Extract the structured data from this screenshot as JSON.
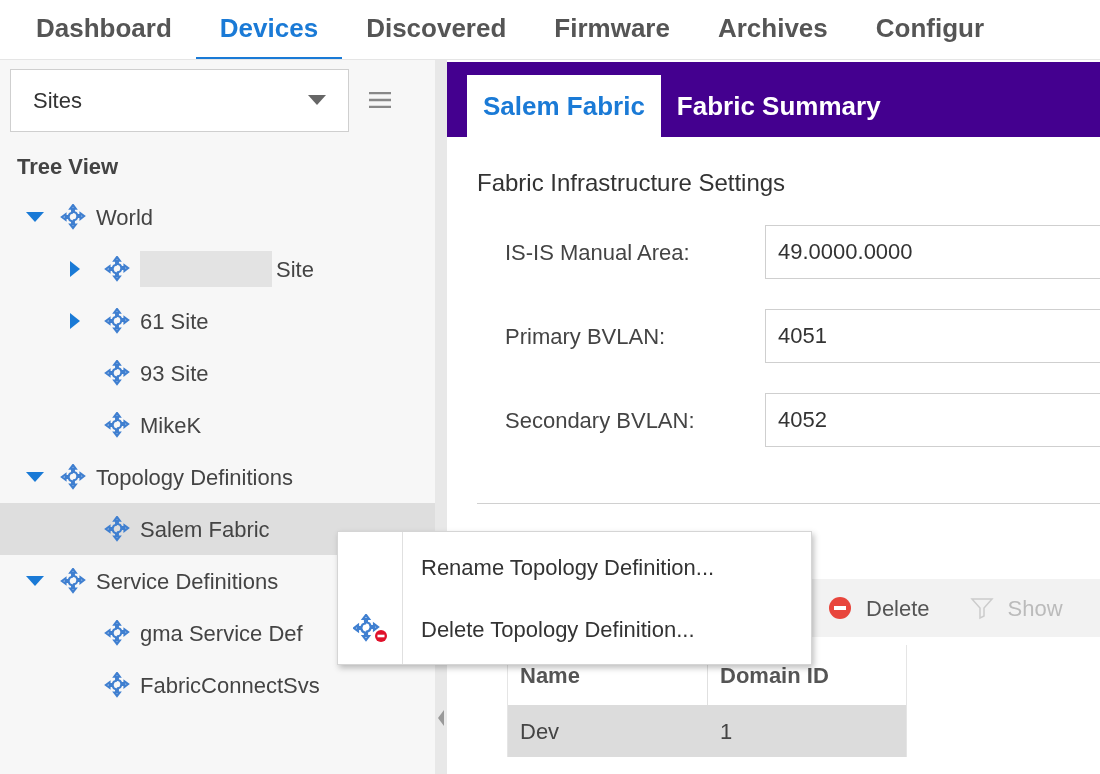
{
  "nav_tabs": [
    {
      "label": "Dashboard",
      "selected": false
    },
    {
      "label": "Devices",
      "selected": true
    },
    {
      "label": "Discovered",
      "selected": false
    },
    {
      "label": "Firmware",
      "selected": false
    },
    {
      "label": "Archives",
      "selected": false
    },
    {
      "label": "Configur",
      "selected": false
    }
  ],
  "sidebar": {
    "dropdown": {
      "value": "Sites"
    },
    "tree_title": "Tree View",
    "tree": [
      {
        "label": "World",
        "expanded": true,
        "selected": false,
        "children": [
          {
            "label": "Site",
            "redacted": true,
            "expanded": false,
            "selected": false
          },
          {
            "label": "61 Site",
            "expanded": false,
            "selected": false
          },
          {
            "label": "93 Site",
            "selected": false
          },
          {
            "label": "MikeK",
            "selected": false
          }
        ]
      },
      {
        "label": "Topology Definitions",
        "expanded": true,
        "selected": false,
        "children": [
          {
            "label": "Salem Fabric",
            "selected": true
          }
        ]
      },
      {
        "label": "Service Definitions",
        "expanded": true,
        "selected": false,
        "children": [
          {
            "label": "gma Service Def",
            "selected": false
          },
          {
            "label": "FabricConnectSvs",
            "selected": false
          }
        ]
      }
    ]
  },
  "content_tabs": [
    {
      "label": "Salem Fabric",
      "selected": true
    },
    {
      "label": "Fabric Summary",
      "selected": false
    }
  ],
  "infrastructure": {
    "title": "Fabric Infrastructure Settings",
    "fields": [
      {
        "label": "IS-IS Manual Area:",
        "value": "49.0000.0000"
      },
      {
        "label": "Primary BVLAN:",
        "value": "4051"
      },
      {
        "label": "Secondary BVLAN:",
        "value": "4052"
      }
    ]
  },
  "dvr": {
    "toolbar": [
      {
        "kind": "delete",
        "label": "Delete",
        "disabled": false
      },
      {
        "kind": "filter",
        "label": "Show",
        "disabled": true
      }
    ],
    "table": {
      "columns": [
        "Name",
        "Domain ID"
      ],
      "rows": [
        {
          "cells": [
            "Dev",
            "1"
          ],
          "selected": true
        }
      ]
    }
  },
  "context_menu": [
    {
      "label": "Rename Topology Definition...",
      "icon": false
    },
    {
      "label": "Delete Topology Definition...",
      "icon": true
    }
  ]
}
